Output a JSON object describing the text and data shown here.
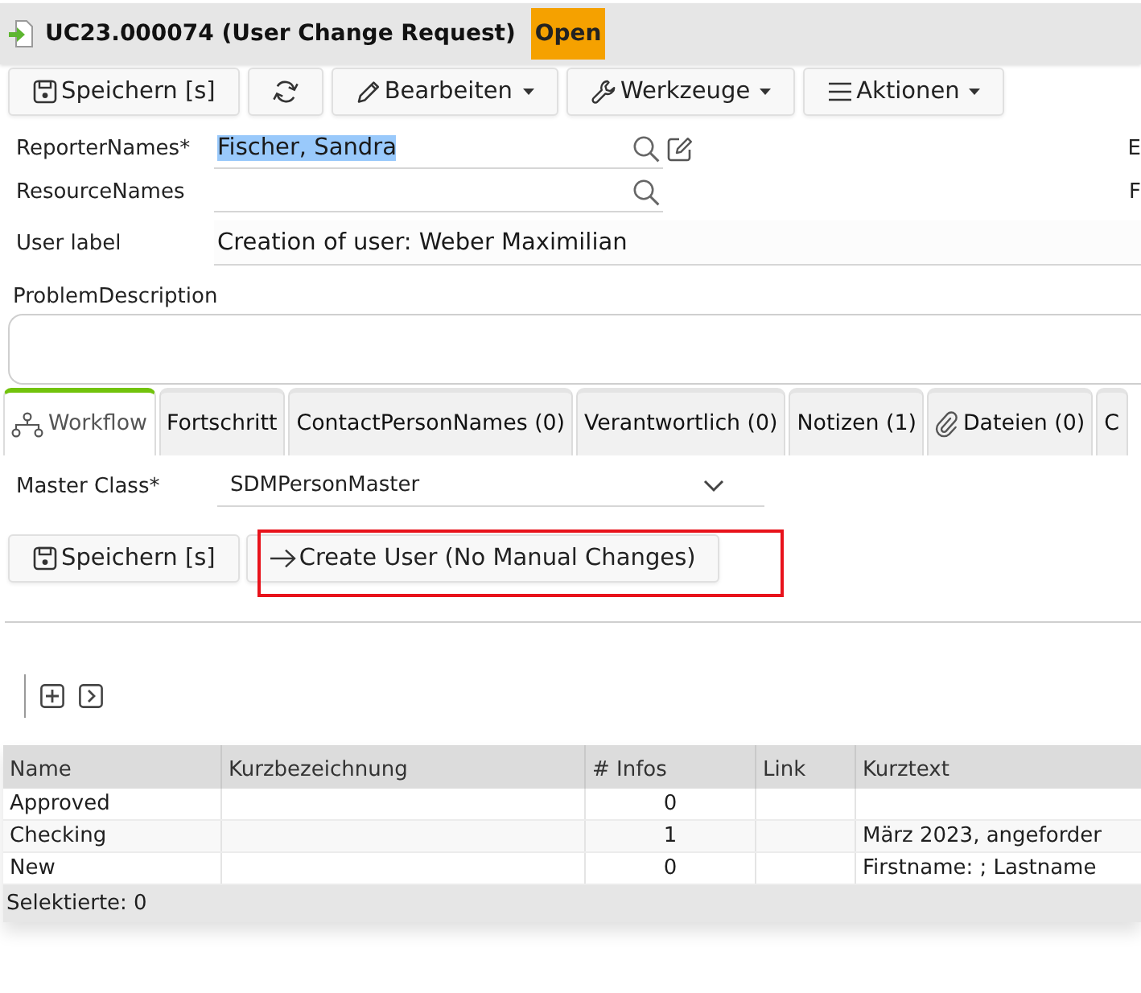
{
  "header": {
    "title": "UC23.000074 (User Change Request)",
    "status": "Open"
  },
  "toolbar": [
    {
      "label": "Speichern [s]",
      "dropdown": false
    },
    {
      "dropdown": false
    },
    {
      "label": "Bearbeiten",
      "dropdown": true
    },
    {
      "label": "Werkzeuge",
      "dropdown": true
    },
    {
      "label": "Aktionen",
      "dropdown": true
    }
  ],
  "fields": [
    {
      "kind": "lookup",
      "label": "ReporterNames*",
      "value": "Fischer, Sandra",
      "highlighted": true,
      "editable": true
    },
    {
      "kind": "lookup",
      "label": "ResourceNames",
      "editable": false
    },
    {
      "kind": "text",
      "label": "User label",
      "value": "Creation of user: Weber Maximilian",
      "highlighted": false
    }
  ],
  "column_2_labels": [
    "E",
    "F"
  ],
  "problem_description": {
    "label": "ProblemDescription"
  },
  "tabs": [
    {
      "label": "Workflow",
      "selected": true
    },
    {
      "label": "Fortschritt",
      "selected": false
    },
    {
      "label": "ContactPersonNames (0)",
      "selected": false
    },
    {
      "label": "Verantwortlich (0)",
      "selected": false
    },
    {
      "label": "Notizen (1)",
      "selected": false
    },
    {
      "label": "Dateien (0)",
      "selected": false
    },
    {
      "label": "C",
      "selected": false
    }
  ],
  "workflow": {
    "master_class": {
      "label": "Master Class*",
      "value": "SDMPersonMaster"
    },
    "actions": [
      {
        "label": "Speichern [s]",
        "highlighted": false
      },
      {
        "label": "Create User (No Manual Changes)",
        "highlighted": true
      }
    ]
  },
  "grid": {
    "columns": [
      "Name",
      "Kurzbezeichnung",
      "# Infos",
      "Link",
      "Kurztext"
    ],
    "rows": [
      {
        "name": "Approved",
        "infos": "0"
      },
      {
        "name": "Checking",
        "infos": "1",
        "kurztext": "März 2023, angeforder"
      },
      {
        "name": "New",
        "infos": "0",
        "kurztext": "Firstname: ; Lastname"
      }
    ],
    "footer": "Selektierte: 0"
  }
}
